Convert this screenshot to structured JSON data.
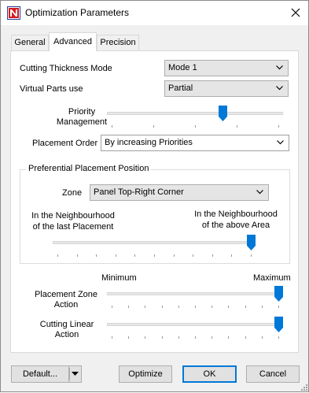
{
  "window": {
    "title": "Optimization Parameters"
  },
  "tabs": [
    {
      "label": "General",
      "active": false
    },
    {
      "label": "Advanced",
      "active": true
    },
    {
      "label": "Precision",
      "active": false
    }
  ],
  "form": {
    "cutting_thickness_mode": {
      "label": "Cutting Thickness Mode",
      "value": "Mode 1"
    },
    "virtual_parts_use": {
      "label": "Virtual Parts use",
      "value": "Partial"
    },
    "priority_management": {
      "label_line1": "Priority",
      "label_line2": "Management",
      "level": 0.6667
    },
    "placement_order": {
      "label": "Placement Order",
      "value": "By increasing Priorities"
    },
    "preferential_placement": {
      "title": "Preferential Placement Position",
      "zone_label": "Zone",
      "zone_value": "Panel Top-Right Corner",
      "left_line1": "In the Neighbourhood",
      "left_line2": "of the last Placement",
      "right_line1": "In the Neighbourhood",
      "right_line2": "of the above Area",
      "level": 1.0
    },
    "scale": {
      "min_label": "Minimum",
      "max_label": "Maximum"
    },
    "placement_zone_action": {
      "label_line1": "Placement Zone",
      "label_line2": "Action",
      "level": 1.0
    },
    "cutting_linear_action": {
      "label_line1": "Cutting Linear",
      "label_line2": "Action",
      "level": 1.0
    }
  },
  "buttons": {
    "default": "Default...",
    "optimize": "Optimize",
    "ok": "OK",
    "cancel": "Cancel"
  },
  "colors": {
    "accent": "#0078d7",
    "app_icon_red": "#d71920",
    "app_icon_blue": "#1e3c96"
  }
}
